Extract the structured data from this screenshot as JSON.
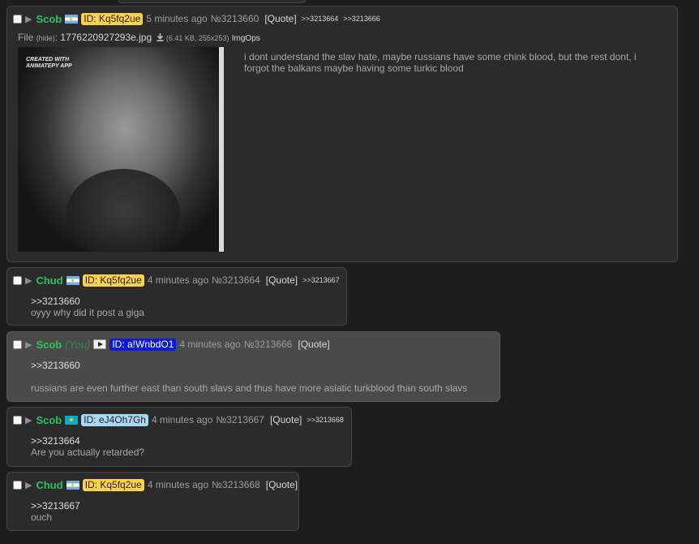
{
  "posts": [
    {
      "name": "Scob",
      "flag": "argentina-flag",
      "id": "ID: Kq5fq2ue",
      "time": "5 minutes ago",
      "no": "№3213660",
      "quote": "[Quote]",
      "replies": [
        ">>3213664",
        ">>3213666"
      ],
      "file": {
        "label": "File",
        "hide": "(hide)",
        "name": "1776220927293e.jpg",
        "meta": "(6.41 KB, 255x253)",
        "imgops": "ImgOps"
      },
      "watermark": [
        "CREATED WITH",
        "ANIMATEPY APP"
      ],
      "text": "i dont understand the slav hate, maybe russians have some chink blood, but the rest dont, i forgot the balkans maybe having some turkic blood"
    },
    {
      "name": "Chud",
      "flag": "argentina-flag",
      "id": "ID: Kq5fq2ue",
      "time": "4 minutes ago",
      "no": "№3213664",
      "quote": "[Quote]",
      "replies": [
        ">>3213667"
      ],
      "quotelink": ">>3213660",
      "text": "oyyy why did it post a giga"
    },
    {
      "name": "Scob",
      "you": "(You)",
      "flag": "play-icon",
      "id": "ID: a!WnbdO1",
      "time": "4 minutes ago",
      "no": "№3213666",
      "quote": "[Quote]",
      "quotelink": ">>3213660",
      "text": "russians are even further east than south slavs and thus have more asiatic turkblood than south slavs"
    },
    {
      "name": "Scob",
      "flag": "kazakhstan-flag",
      "id": "ID: eJ4Oh7Gh",
      "time": "4 minutes ago",
      "no": "№3213667",
      "quote": "[Quote]",
      "replies": [
        ">>3213668"
      ],
      "quotelink": ">>3213664",
      "text": "Are you actually retarded?"
    },
    {
      "name": "Chud",
      "flag": "argentina-flag",
      "id": "ID: Kq5fq2ue",
      "time": "4 minutes ago",
      "no": "№3213668",
      "quote": "[Quote]",
      "quotelink": ">>3213667",
      "text": "ouch"
    }
  ]
}
